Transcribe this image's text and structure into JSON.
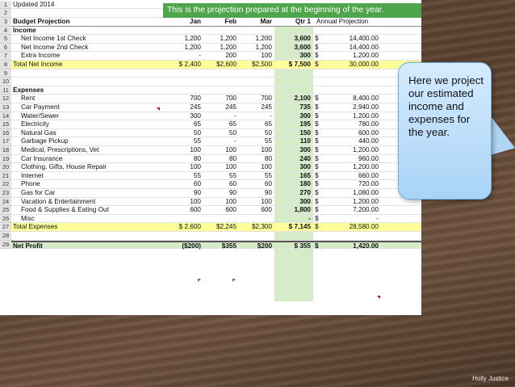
{
  "banner": "This is the projection prepared at the beginning of the year.",
  "updated": "Updated 2014",
  "row_numbers": [
    "1",
    "2",
    "3",
    "4",
    "5",
    "6",
    "7",
    "8",
    "9",
    "10",
    "11",
    "12",
    "13",
    "14",
    "15",
    "16",
    "17",
    "18",
    "19",
    "20",
    "21",
    "22",
    "23",
    "24",
    "25",
    "26",
    "27",
    "28",
    "29"
  ],
  "columns": {
    "label": "Budget Projection",
    "jan": "Jan",
    "feb": "Feb",
    "mar": "Mar",
    "q1": "Qtr 1",
    "annual": "Annual Projection"
  },
  "income_header": "Income",
  "income_rows": [
    {
      "label": "Net Income 1st Check",
      "jan": "1,200",
      "feb": "1,200",
      "mar": "1,200",
      "q1": "3,600",
      "dol": "$",
      "annual": "14,400.00"
    },
    {
      "label": "Net Income 2nd Check",
      "jan": "1,200",
      "feb": "1,200",
      "mar": "1,200",
      "q1": "3,600",
      "dol": "$",
      "annual": "14,400.00"
    },
    {
      "label": "Extra Income",
      "jan": "-",
      "feb": "200",
      "mar": "100",
      "q1": "300",
      "dol": "$",
      "annual": "1,200.00"
    }
  ],
  "total_income": {
    "label": "Total Net Income",
    "jan": "$  2,400",
    "feb": "$2,600",
    "mar": "$2,500",
    "q1": "$  7,500",
    "dol": "$",
    "annual": "30,000.00"
  },
  "expenses_header": "Expenses",
  "expense_rows": [
    {
      "label": "Rent",
      "jan": "700",
      "feb": "700",
      "mar": "700",
      "q1": "2,100",
      "dol": "$",
      "annual": "8,400.00"
    },
    {
      "label": "Car Payment",
      "jan": "245",
      "feb": "245",
      "mar": "245",
      "q1": "735",
      "dol": "$",
      "annual": "2,940.00"
    },
    {
      "label": "Water/Sewer",
      "jan": "300",
      "feb": "-",
      "mar": "-",
      "q1": "300",
      "dol": "$",
      "annual": "1,200.00"
    },
    {
      "label": "Electricity",
      "jan": "65",
      "feb": "65",
      "mar": "65",
      "q1": "195",
      "dol": "$",
      "annual": "780.00"
    },
    {
      "label": "Natural Gas",
      "jan": "50",
      "feb": "50",
      "mar": "50",
      "q1": "150",
      "dol": "$",
      "annual": "600.00"
    },
    {
      "label": "Garbage Pickup",
      "jan": "55",
      "feb": "-",
      "mar": "55",
      "q1": "110",
      "dol": "$",
      "annual": "440.00"
    },
    {
      "label": "Medical, Prescriptions, Vet",
      "jan": "100",
      "feb": "100",
      "mar": "100",
      "q1": "300",
      "dol": "$",
      "annual": "1,200.00"
    },
    {
      "label": "Car Insurance",
      "jan": "80",
      "feb": "80",
      "mar": "80",
      "q1": "240",
      "dol": "$",
      "annual": "960.00"
    },
    {
      "label": "Clothing, Gifts, House Repair",
      "jan": "100",
      "feb": "100",
      "mar": "100",
      "q1": "300",
      "dol": "$",
      "annual": "1,200.00"
    },
    {
      "label": "Internet",
      "jan": "55",
      "feb": "55",
      "mar": "55",
      "q1": "165",
      "dol": "$",
      "annual": "660.00"
    },
    {
      "label": "Phone",
      "jan": "60",
      "feb": "60",
      "mar": "60",
      "q1": "180",
      "dol": "$",
      "annual": "720.00"
    },
    {
      "label": "Gas for Car",
      "jan": "90",
      "feb": "90",
      "mar": "90",
      "q1": "270",
      "dol": "$",
      "annual": "1,080.00"
    },
    {
      "label": "Vacation & Entertainment",
      "jan": "100",
      "feb": "100",
      "mar": "100",
      "q1": "300",
      "dol": "$",
      "annual": "1,200.00"
    },
    {
      "label": "Food & Supplies & Eating Out",
      "jan": "600",
      "feb": "600",
      "mar": "600",
      "q1": "1,800",
      "dol": "$",
      "annual": "7,200.00"
    },
    {
      "label": "Misc",
      "jan": "",
      "feb": "",
      "mar": "",
      "q1": "-",
      "dol": "$",
      "annual": "-"
    }
  ],
  "total_expenses": {
    "label": "Total Expenses",
    "jan": "$  2,600",
    "feb": "$2,245",
    "mar": "$2,300",
    "q1": "$  7,145",
    "dol": "$",
    "annual": "28,580.00"
  },
  "net_profit": {
    "label": "Net Profit",
    "jan": "($200)",
    "feb": "$355",
    "mar": "$200",
    "q1": "$     355",
    "dol": "$",
    "annual": "1,420.00"
  },
  "callout": "Here we project our estimated income and expenses for the year.",
  "credit": "Holly Justice",
  "colors": {
    "banner": "#4fa54b",
    "qtr_fill": "#d6ecc9",
    "total_fill": "#ffff99",
    "callout": "#a9d3f5"
  }
}
